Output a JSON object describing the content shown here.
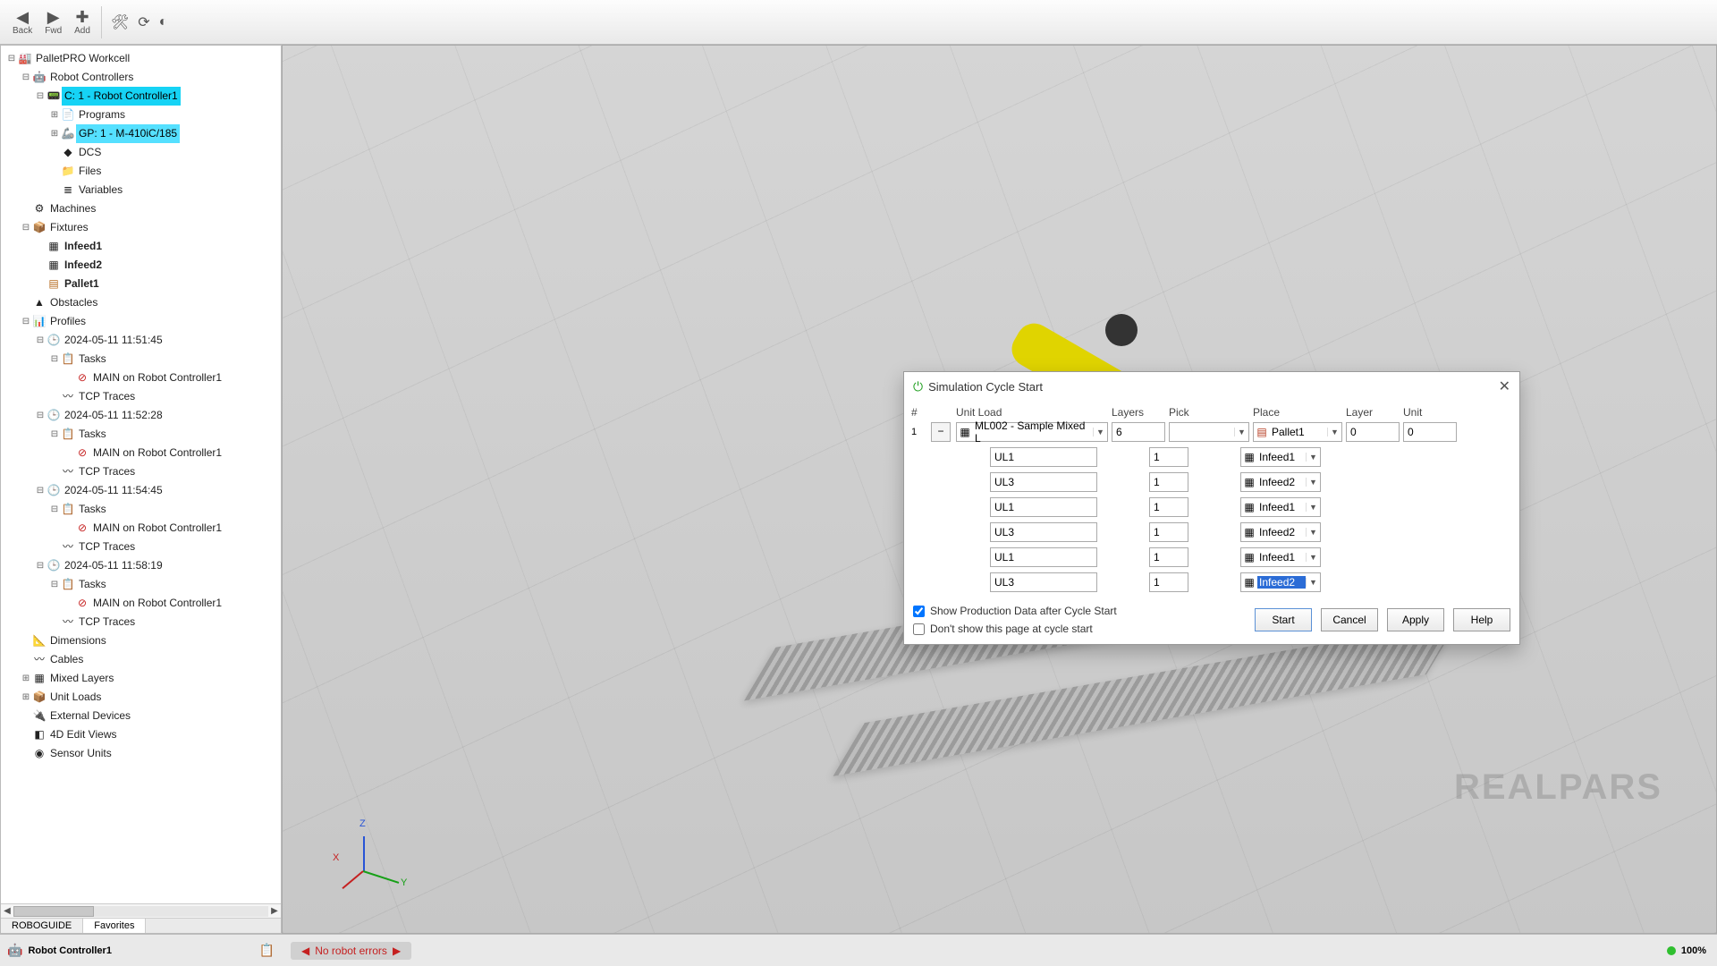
{
  "toolbar": {
    "back": "Back",
    "fwd": "Fwd",
    "add": "Add"
  },
  "tree": {
    "root": "PalletPRO Workcell",
    "robot_controllers": "Robot Controllers",
    "controller1": "C: 1 - Robot Controller1",
    "programs": "Programs",
    "gp1": "GP: 1 - M-410iC/185",
    "dcs": "DCS",
    "files": "Files",
    "variables": "Variables",
    "machines": "Machines",
    "fixtures": "Fixtures",
    "infeed1": "Infeed1",
    "infeed2": "Infeed2",
    "pallet1": "Pallet1",
    "obstacles": "Obstacles",
    "profiles": "Profiles",
    "profile1": "2024-05-11 11:51:45",
    "profile2": "2024-05-11 11:52:28",
    "profile3": "2024-05-11 11:54:45",
    "profile4": "2024-05-11 11:58:19",
    "tasks": "Tasks",
    "main_task": "MAIN on Robot Controller1",
    "tcp_traces": "TCP Traces",
    "dimensions": "Dimensions",
    "cables": "Cables",
    "mixed_layers": "Mixed Layers",
    "unit_loads": "Unit Loads",
    "external_devices": "External Devices",
    "4d_views": "4D Edit Views",
    "sensor_units": "Sensor Units",
    "tab_tree": "ROBOGUIDE",
    "tab_fav": "Favorites"
  },
  "viewport": {
    "watermark": "REALPARS",
    "axis_x": "X",
    "axis_y": "Y",
    "axis_z": "Z"
  },
  "dialog": {
    "title": "Simulation Cycle Start",
    "headers": {
      "num": "#",
      "unitload": "Unit Load",
      "layers": "Layers",
      "pick": "Pick",
      "place": "Place",
      "layer": "Layer",
      "unit": "Unit"
    },
    "row1": {
      "num": "1",
      "unitload": "ML002 - Sample Mixed L",
      "layers": "6",
      "pick": "",
      "place": "Pallet1",
      "layer": "0",
      "unit": "0"
    },
    "subs": [
      {
        "ul": "UL1",
        "ly": "1",
        "pk": "Infeed1"
      },
      {
        "ul": "UL3",
        "ly": "1",
        "pk": "Infeed2"
      },
      {
        "ul": "UL1",
        "ly": "1",
        "pk": "Infeed1"
      },
      {
        "ul": "UL3",
        "ly": "1",
        "pk": "Infeed2"
      },
      {
        "ul": "UL1",
        "ly": "1",
        "pk": "Infeed1"
      },
      {
        "ul": "UL3",
        "ly": "1",
        "pk": "Infeed2"
      }
    ],
    "check1": "Show Production Data after Cycle Start",
    "check2": "Don't show this page at cycle start",
    "start": "Start",
    "cancel": "Cancel",
    "apply": "Apply",
    "help": "Help"
  },
  "status": {
    "controller": "Robot Controller1",
    "error": "No robot errors",
    "zoom": "100%"
  }
}
